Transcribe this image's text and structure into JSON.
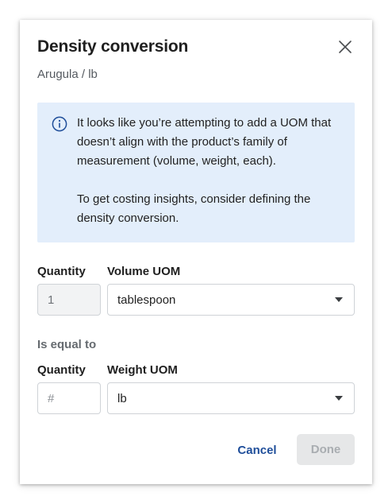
{
  "dialog": {
    "title": "Density conversion",
    "subtitle": "Arugula / lb",
    "close_icon": "close-icon"
  },
  "info": {
    "icon": "info-icon",
    "paragraph1": "It looks like you’re attempting to add a UOM that doesn’t align with the product’s family of measurement (volume, weight, each).",
    "paragraph2": "To get costing insights, consider defining the density conversion.",
    "background_color": "#e3eefb"
  },
  "volume_row": {
    "quantity_label": "Quantity",
    "quantity_value": "1",
    "uom_label": "Volume UOM",
    "uom_value": "tablespoon"
  },
  "equal_label": "Is equal to",
  "weight_row": {
    "quantity_label": "Quantity",
    "quantity_placeholder": "#",
    "uom_label": "Weight UOM",
    "uom_value": "lb"
  },
  "actions": {
    "cancel_label": "Cancel",
    "done_label": "Done",
    "accent_color": "#1f4e9a"
  }
}
